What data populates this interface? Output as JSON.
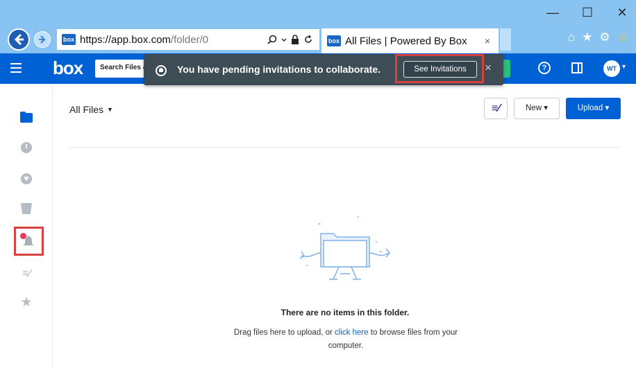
{
  "browser": {
    "url_host": "https://app.box.com",
    "url_path": "/folder/0",
    "favicon_label": "box",
    "tab_title": "All Files | Powered By Box",
    "tab_close": "×",
    "window_controls": {
      "minimize": "—",
      "maximize": "☐",
      "close": "✕"
    },
    "address_icons": [
      "search-icon",
      "dropdown-icon",
      "lock-icon",
      "refresh-icon"
    ],
    "toolbar_icons": [
      "home-icon",
      "star-icon",
      "gear-icon",
      "smiley-icon"
    ]
  },
  "appbar": {
    "logo": "box",
    "search_placeholder": "Search Files and Folders",
    "help_label": "?",
    "avatar_initials": "WT",
    "color_primary": "#0061d5"
  },
  "notification": {
    "message": "You have pending invitations to collaborate.",
    "button_label": "See Invitations",
    "close_label": "×",
    "highlight_color": "#d8413f"
  },
  "sidebar": {
    "items": [
      {
        "name": "all-files",
        "icon": "folder-icon",
        "active": true
      },
      {
        "name": "recents",
        "icon": "clock-icon"
      },
      {
        "name": "synced",
        "icon": "download-icon"
      },
      {
        "name": "trash",
        "icon": "trash-icon"
      },
      {
        "name": "notifications",
        "icon": "bell-icon",
        "badge": true,
        "highlighted": true
      },
      {
        "name": "notes",
        "icon": "notes-icon"
      },
      {
        "name": "favorites",
        "icon": "star-icon"
      }
    ]
  },
  "main": {
    "title": "All Files",
    "notes_button": "≡⁄",
    "new_button": "New",
    "upload_button": "Upload",
    "empty": {
      "title": "There are no items in this folder.",
      "desc_prefix": "Drag files here to upload, or ",
      "desc_link": "click here",
      "desc_suffix": " to browse files from your computer."
    }
  }
}
